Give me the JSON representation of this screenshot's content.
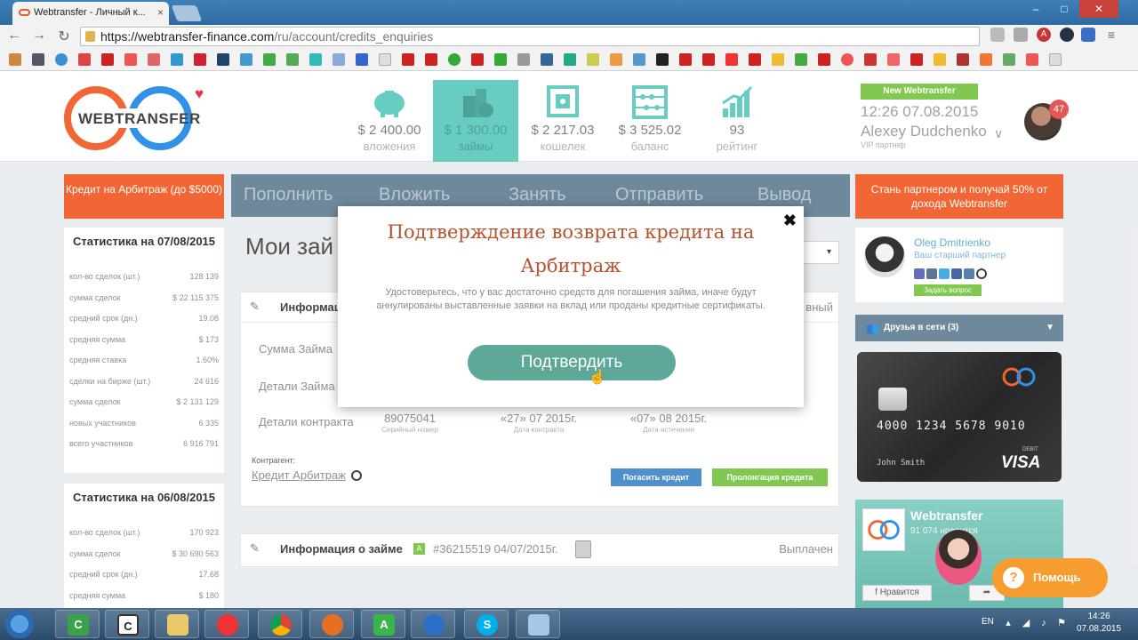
{
  "browser": {
    "tab_title": "Webtransfer - Личный к...",
    "url_host": "https://webtransfer-finance.com",
    "url_path": "/ru/account/credits_enquiries",
    "close_glyph": "×"
  },
  "header": {
    "logo_text": "WEBTRANSFER",
    "stats": [
      {
        "value": "$ 2 400.00",
        "label": "вложения",
        "icon": "piggy-bank-icon"
      },
      {
        "value": "$ 1 300.00",
        "label": "займы",
        "icon": "coins-icon"
      },
      {
        "value": "$ 2 217.03",
        "label": "кошелек",
        "icon": "safe-icon"
      },
      {
        "value": "$ 3 525.02",
        "label": "баланс",
        "icon": "abacus-icon"
      },
      {
        "value": "93",
        "label": "рейтинг",
        "icon": "chart-up-icon"
      }
    ],
    "new_webtransfer": "New Webtransfer",
    "time": "12:26 07.08.2015",
    "user_name": "Alexey Dudchenko",
    "user_role": "VIP партнер",
    "notifications": "47"
  },
  "left": {
    "promo": "Кредит на Арбитраж (до $5000)",
    "stats_boxes": [
      {
        "title": "Статистика на 07/08/2015",
        "rows": [
          {
            "label": "кол-во сделок (шт.)",
            "value": "128 139"
          },
          {
            "label": "сумма сделок",
            "value": "$ 22 115 375"
          },
          {
            "label": "средний срок (дн.)",
            "value": "19.08"
          },
          {
            "label": "средняя сумма",
            "value": "$ 173"
          },
          {
            "label": "средняя ставка",
            "value": "1.60%"
          },
          {
            "label": "сделки на бирже (шт.)",
            "value": "24 616"
          },
          {
            "label": "сумма сделок",
            "value": "$ 2 131 129"
          },
          {
            "label": "новых участников",
            "value": "6 335"
          },
          {
            "label": "всего участников",
            "value": "6 916 791"
          }
        ]
      },
      {
        "title": "Статистика на 06/08/2015",
        "rows": [
          {
            "label": "кол-во сделок (шт.)",
            "value": "170 923"
          },
          {
            "label": "сумма сделок",
            "value": "$ 30 690 563"
          },
          {
            "label": "средний срок (дн.)",
            "value": "17.68"
          },
          {
            "label": "средняя сумма",
            "value": "$ 180"
          }
        ]
      }
    ]
  },
  "menu": [
    "Пополнить",
    "Вложить",
    "Занять",
    "Отправить",
    "Вывод"
  ],
  "main": {
    "page_title": "Мои зай",
    "card1": {
      "title": "Информация",
      "status": "вный",
      "label_amount": "Сумма Займа",
      "label_details": "Детали Займа",
      "label_contract": "Детали контракта",
      "serial": "89075041",
      "serial_label": "Серийный номер",
      "contract_date": "«27» 07 2015г.",
      "contract_date_label": "Дата контракта",
      "expiry_date": "«07» 08 2015г.",
      "expiry_date_label": "Дата истечения",
      "counterparty_label": "Контрагент:",
      "counterparty": "Кредит Арбитраж",
      "repay_btn": "Погасить кредит",
      "prolong_btn": "Пролонгация кредита"
    },
    "card2": {
      "title": "Информация о займе",
      "badge": "A",
      "ref": "#36215519 04/07/2015г.",
      "status": "Выплачен"
    }
  },
  "right": {
    "promo": "Стань партнером и получай 50% от дохода Webtransfer",
    "partner_name": "Oleg Dmitrienko",
    "partner_role": "Ваш старший партнер",
    "ask_btn": "Задать вопрос",
    "friends": "Друзья в сети (3)",
    "card": {
      "number": "4000 1234 5678 9010",
      "holder": "John Smith",
      "debit": "DEBIT",
      "brand": "VISA"
    },
    "fb": {
      "title": "Webtransfer",
      "likes": "91 074 нравится",
      "like_btn": "Нравится"
    },
    "help": "Помощь"
  },
  "modal": {
    "title": "Подтверждение возврата кредита на Арбитраж",
    "text": "Удостоверьтесь, что у вас достаточно средств для погашения займа, иначе будут аннулированы выставленные заявки на вклад или проданы кредитные сертификаты.",
    "confirm": "Подтвердить",
    "close": "✖"
  },
  "taskbar": {
    "lang": "EN",
    "time": "14:26",
    "date": "07.08.2015"
  },
  "colors": {
    "orange": "#f15a24",
    "teal": "#5bc9bc",
    "green": "#76c442",
    "slate": "#637f94",
    "modal_title": "#b5532e",
    "confirm": "#5ea899"
  }
}
